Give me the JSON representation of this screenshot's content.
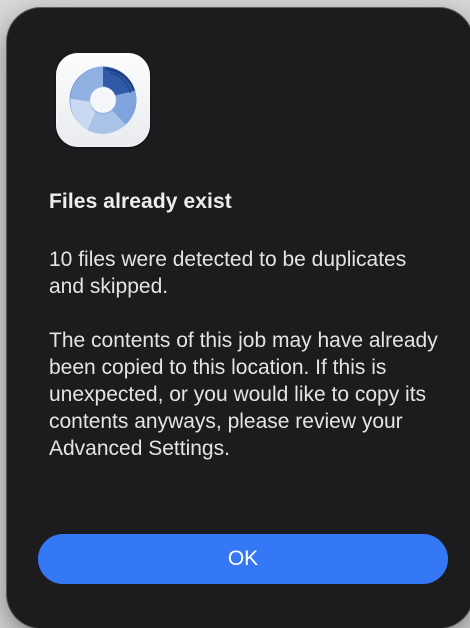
{
  "dialog": {
    "app_icon": "aperture-shutter-icon",
    "title": "Files already exist",
    "message_paragraphs": [
      "10 files were detected to be duplicates and skipped.",
      "The contents of this job may have already been copied to this location. If this is unexpected, or you would like to copy its contents anyways, please review your Advanced Settings."
    ],
    "ok_label": "OK"
  },
  "colors": {
    "dialog_background": "#1c1c1e",
    "accent_button": "#3478f6",
    "text": "#e4e4e4"
  }
}
